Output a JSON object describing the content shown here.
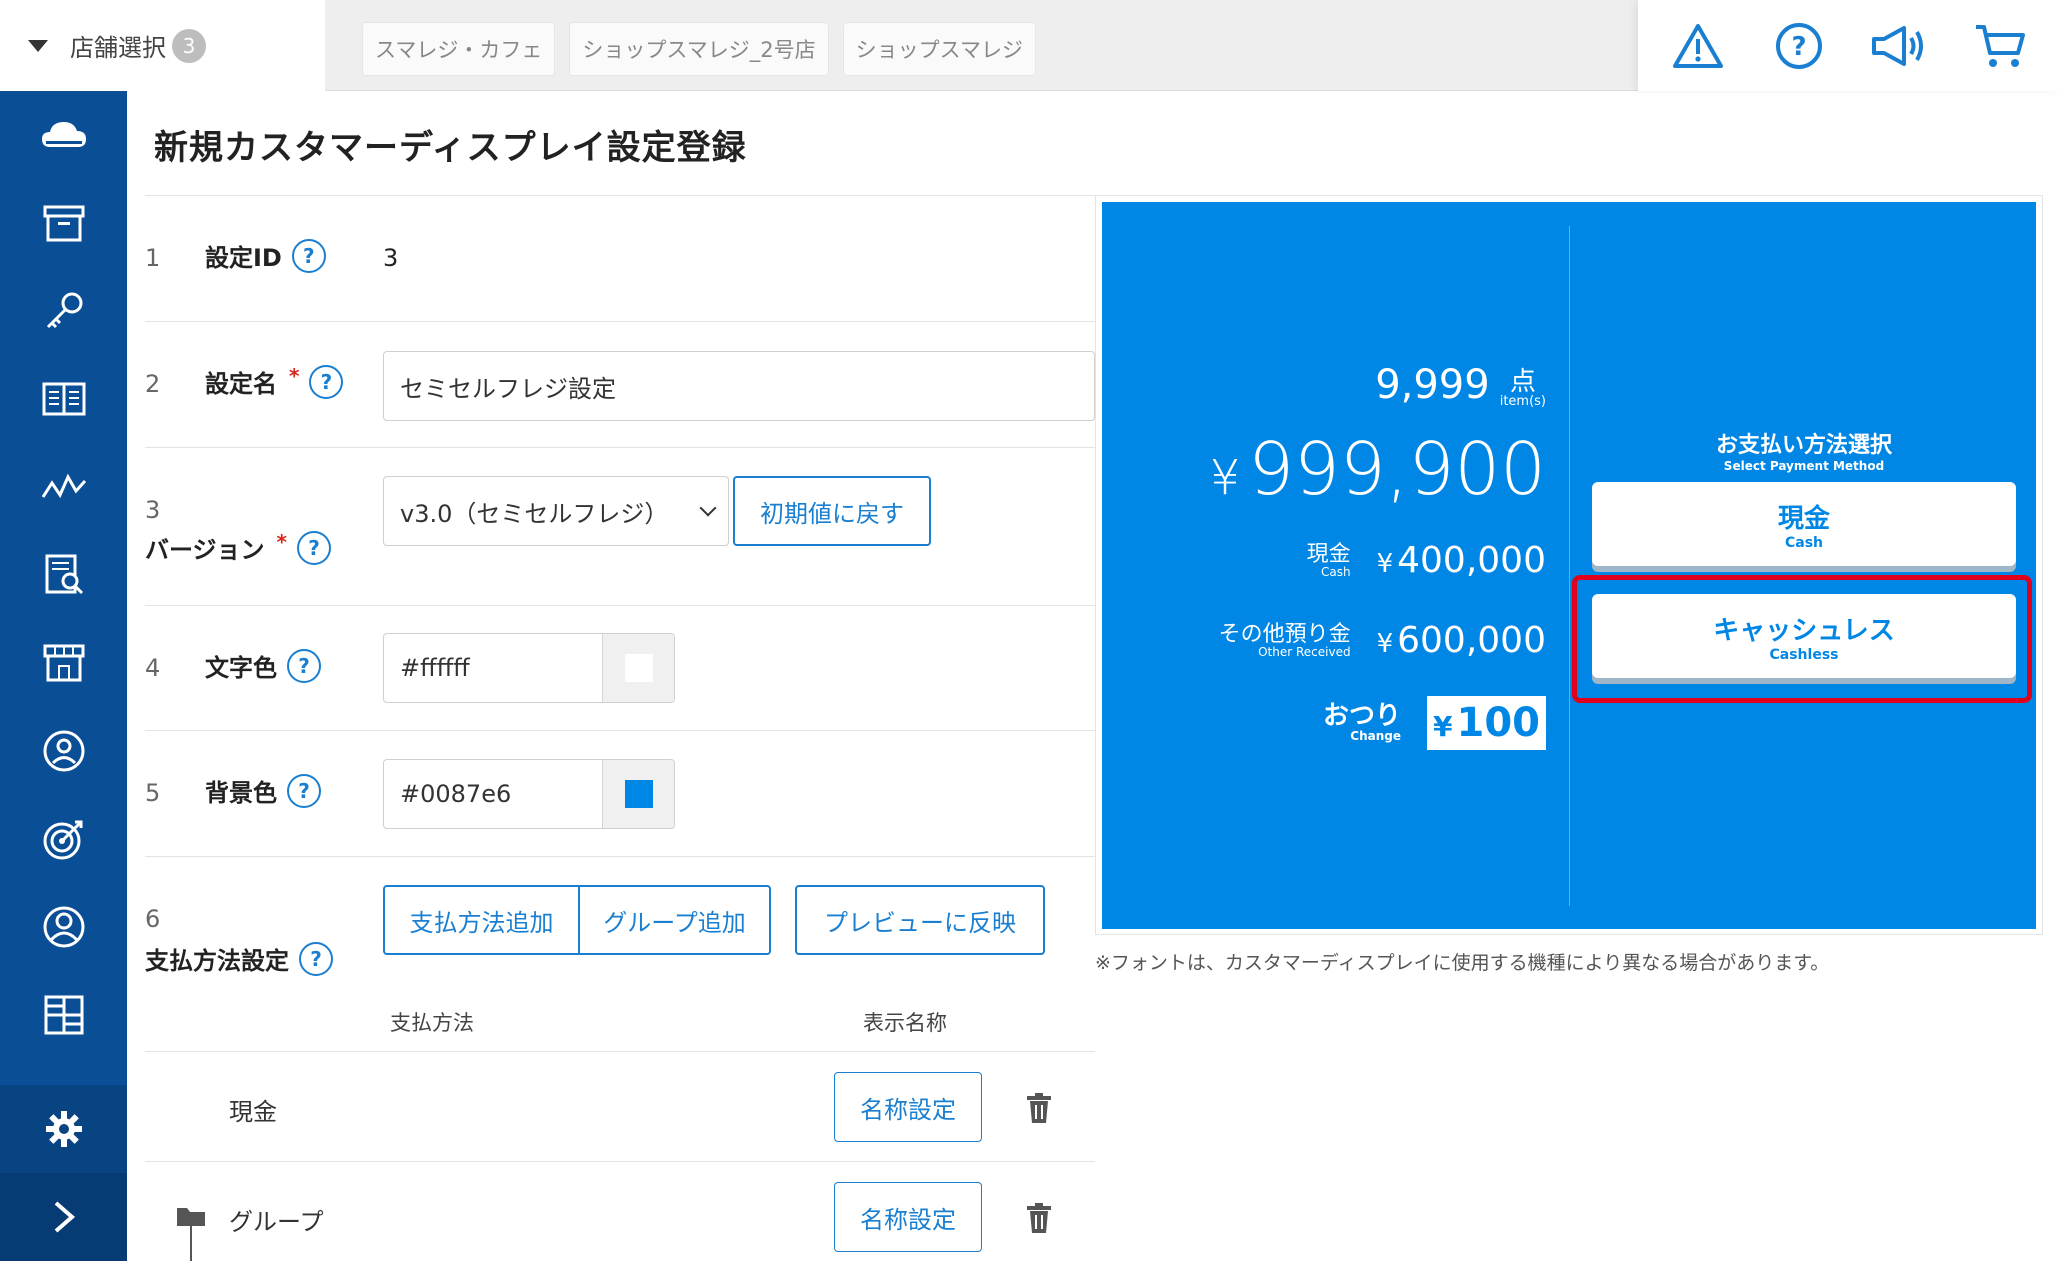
{
  "header": {
    "store_select_label": "店舗選択",
    "store_count": "3",
    "stores": [
      "スマレジ・カフェ",
      "ショップスマレジ_2号店",
      "ショップスマレジ"
    ]
  },
  "page": {
    "title": "新規カスタマーディスプレイ設定登録"
  },
  "form": {
    "rows": [
      {
        "num": "1",
        "label": "設定ID",
        "value": "3"
      },
      {
        "num": "2",
        "label": "設定名",
        "value": "セミセルフレジ設定"
      },
      {
        "num": "3",
        "label": "バージョン",
        "value": "v3.0（セミセルフレジ）",
        "button": "初期値に戻す"
      },
      {
        "num": "4",
        "label": "文字色",
        "value": "#ffffff"
      },
      {
        "num": "5",
        "label": "背景色",
        "value": "#0087e6"
      },
      {
        "num": "6",
        "label": "支払方法設定"
      }
    ],
    "help_mark": "?",
    "required_mark": "*",
    "buttons": {
      "add_payment": "支払方法追加",
      "add_group": "グループ追加",
      "apply_preview": "プレビューに反映"
    },
    "table_headers": {
      "method": "支払方法",
      "display_name": "表示名称"
    },
    "payment_rows": [
      {
        "name": "現金",
        "button": "名称設定"
      },
      {
        "name": "グループ",
        "button": "名称設定"
      }
    ]
  },
  "preview": {
    "items_count": "9,999",
    "items_unit": "点",
    "items_unit_en": "item(s)",
    "yen": "¥",
    "total": "999,900",
    "cash_label": "現金",
    "cash_label_en": "Cash",
    "cash_amount": "400,000",
    "other_label": "その他預り金",
    "other_label_en": "Other Received",
    "other_amount": "600,000",
    "change_label": "おつり",
    "change_label_en": "Change",
    "change_amount": "100",
    "select_title": "お支払い方法選択",
    "select_title_en": "Select Payment Method",
    "btn_cash": "現金",
    "btn_cash_en": "Cash",
    "btn_cashless": "キャッシュレス",
    "btn_cashless_en": "Cashless",
    "note": "※フォントは、カスタマーディスプレイに使用する機種により異なる場合があります。"
  },
  "colors": {
    "sidebar": "#0a4f96",
    "accent": "#1a7fd0",
    "preview_bg": "#0087e6",
    "text_color": "#ffffff",
    "highlight": "#e0001b"
  }
}
